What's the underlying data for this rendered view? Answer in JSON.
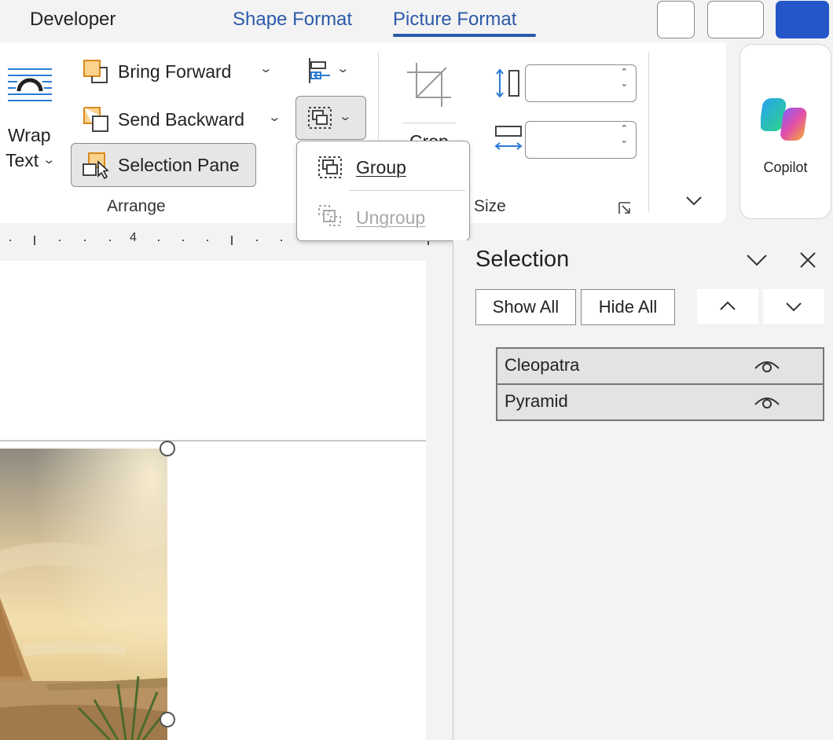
{
  "tabs": {
    "developer": "Developer",
    "shape_format": "Shape Format",
    "picture_format": "Picture Format"
  },
  "ribbon": {
    "wrap_text_line1": "Wrap",
    "wrap_text_line2": "Text",
    "bring_forward": "Bring Forward",
    "send_backward": "Send Backward",
    "selection_pane": "Selection Pane",
    "arrange_label": "Arrange",
    "crop_partial": "Crop",
    "size_label": "Size",
    "height_value": "",
    "width_value": "",
    "copilot": "Copilot"
  },
  "ruler": {
    "mark": "4"
  },
  "group_menu": {
    "group": "Group",
    "ungroup": "Ungroup"
  },
  "selection_pane": {
    "title": "Selection",
    "show_all": "Show All",
    "hide_all": "Hide All",
    "objects": [
      {
        "name": "Cleopatra",
        "visible": true
      },
      {
        "name": "Pyramid",
        "visible": true
      }
    ]
  },
  "colors": {
    "accent": "#2b5aa8",
    "primary_button": "#2456c8",
    "icon_orange": "#f5a623"
  }
}
